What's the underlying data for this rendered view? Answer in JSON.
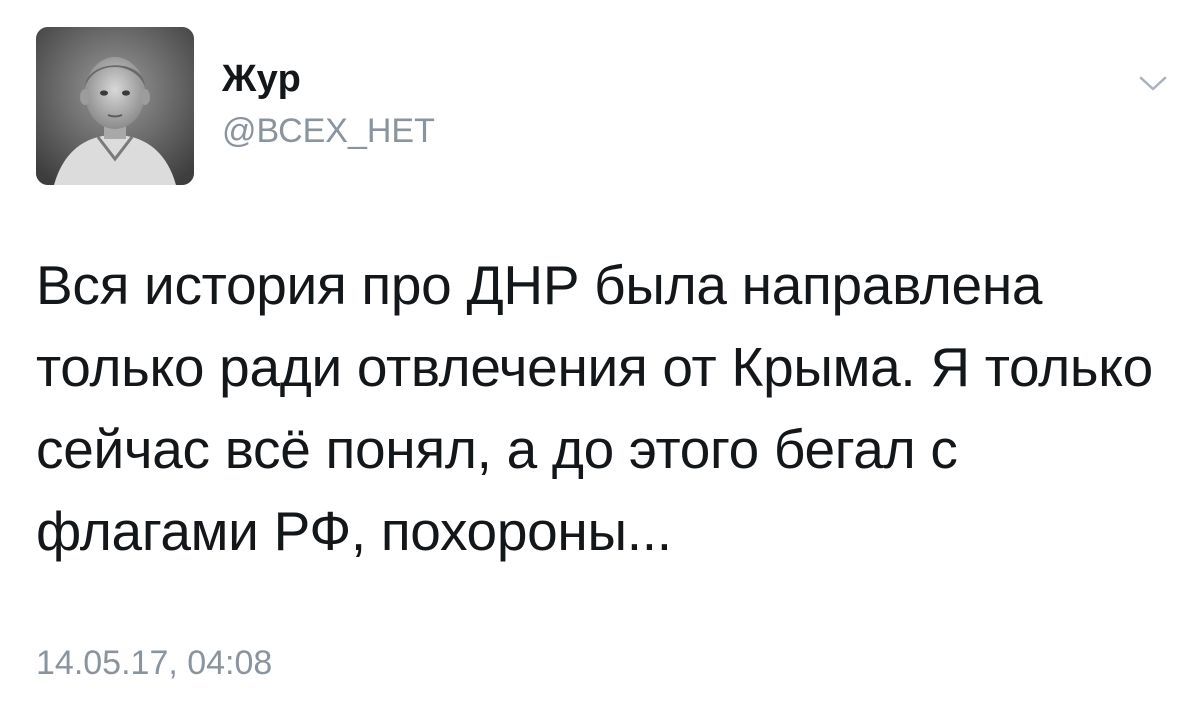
{
  "tweet": {
    "author": {
      "display_name": "Жур",
      "handle": "@ВСЕХ_НЕТ",
      "avatar_icon": "avatar-photo"
    },
    "menu_icon": "chevron-down-icon",
    "text": "Вся история про ДНР была направлена только ради отвлечения от Крыма. Я только сейчас всё понял, а до этого бегал с флагами РФ, похороны...",
    "timestamp": "14.05.17, 04:08"
  },
  "colors": {
    "text_primary": "#14171a",
    "text_secondary": "#8a949e",
    "background": "#ffffff"
  }
}
